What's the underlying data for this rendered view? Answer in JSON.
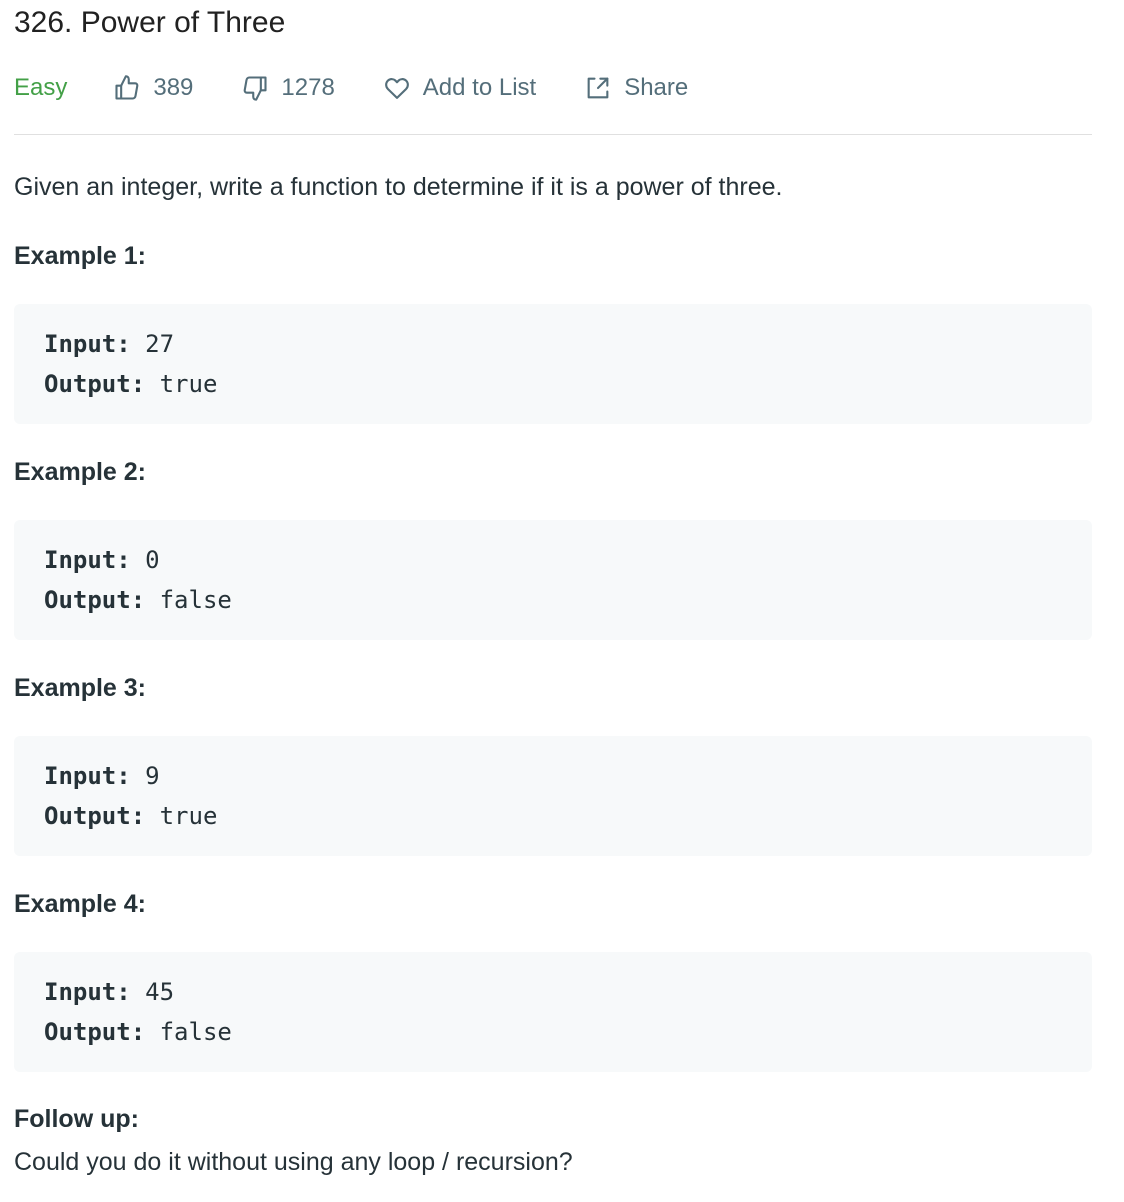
{
  "problem": {
    "title": "326. Power of Three",
    "difficulty": "Easy",
    "likes": "389",
    "dislikes": "1278",
    "add_to_list_label": "Add to List",
    "share_label": "Share",
    "description": "Given an integer, write a function to determine if it is a power of three."
  },
  "examples": [
    {
      "heading": "Example 1:",
      "input_label": "Input:",
      "input_value": "27",
      "output_label": "Output:",
      "output_value": "true"
    },
    {
      "heading": "Example 2:",
      "input_label": "Input:",
      "input_value": "0",
      "output_label": "Output:",
      "output_value": "false"
    },
    {
      "heading": "Example 3:",
      "input_label": "Input:",
      "input_value": "9",
      "output_label": "Output:",
      "output_value": "true"
    },
    {
      "heading": "Example 4:",
      "input_label": "Input:",
      "input_value": "45",
      "output_label": "Output:",
      "output_value": "false"
    }
  ],
  "follow_up": {
    "heading": "Follow up:",
    "text": "Could you do it without using any loop / recursion?"
  },
  "colors": {
    "difficulty_easy": "#43a047",
    "text": "#263238",
    "muted": "#546e7a",
    "code_bg": "#f7f9fa"
  },
  "icons": {
    "like": "thumbs-up-icon",
    "dislike": "thumbs-down-icon",
    "add_to_list": "heart-icon",
    "share": "share-icon"
  }
}
